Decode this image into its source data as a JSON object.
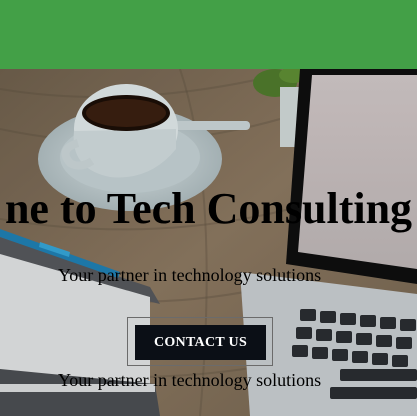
{
  "colors": {
    "header_bar": "#43a047",
    "button_bg": "#0b0f16",
    "button_text": "#ffffff"
  },
  "hero": {
    "title": "ne to Tech Consulting",
    "subtitle": "Your partner in technology solutions",
    "subtitle_repeat": "Your partner in technology solutions",
    "cta_label": "CONTACT US",
    "background": "desk-photo-coffee-laptop"
  }
}
